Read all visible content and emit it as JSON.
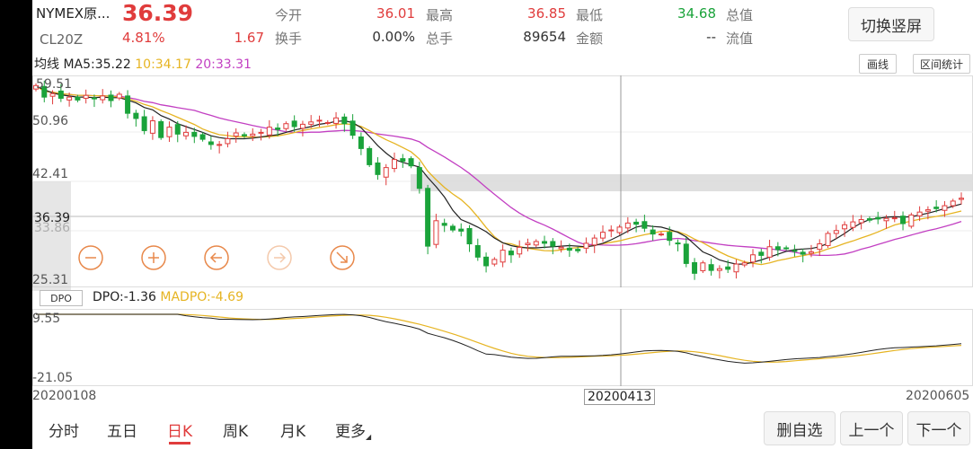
{
  "quote": {
    "name": "NYMEX原...",
    "code": "CL20Z",
    "price": "36.39",
    "change_pct": "4.81%",
    "change": "1.67",
    "fields": [
      {
        "label": "今开",
        "value": "36.01",
        "color": "#e03c3c"
      },
      {
        "label": "最高",
        "value": "36.85",
        "color": "#e03c3c"
      },
      {
        "label": "最低",
        "value": "34.68",
        "color": "#1aa33a"
      },
      {
        "label": "总值",
        "value": "--",
        "color": "#333333"
      },
      {
        "label": "换手",
        "value": "0.00%",
        "color": "#333333"
      },
      {
        "label": "总手",
        "value": "89654",
        "color": "#333333"
      },
      {
        "label": "金额",
        "value": "--",
        "color": "#333333"
      },
      {
        "label": "流值",
        "value": "--",
        "color": "#333333"
      }
    ],
    "switch_label": "切换竖屏"
  },
  "ma_header": {
    "title": "均线",
    "ma5": "MA5:35.22",
    "ma10": "10:34.17",
    "ma20": "20:33.31",
    "draw_label": "画线",
    "range_stat_label": "区间统计"
  },
  "price_axis": {
    "top": "59.51",
    "l2": "50.96",
    "l3": "42.41",
    "current": "36.39",
    "l4": "33.86",
    "bottom": "25.31"
  },
  "indicator": {
    "badge": "DPO",
    "dpo": "DPO:-1.36",
    "madpo": "MADPO:-4.69",
    "top": "9.55",
    "bottom": "-21.05"
  },
  "dates": {
    "start": "20200108",
    "cursor": "20200413",
    "end": "20200605"
  },
  "tabs": [
    "分时",
    "五日",
    "日K",
    "周K",
    "月K",
    "更多"
  ],
  "buttons": {
    "delete": "删自选",
    "prev": "上一个",
    "next": "下一个"
  },
  "colors": {
    "up": "#e03c3c",
    "down": "#1aa33a",
    "ma5": "#222222",
    "ma10": "#e6b422",
    "ma20": "#c23fc2"
  },
  "chart_data": {
    "type": "candlestick",
    "ylim": [
      25.31,
      59.51
    ],
    "closes": [
      59.0,
      57.0,
      57.6,
      56.8,
      57.0,
      56.5,
      57.3,
      56.7,
      57.2,
      56.4,
      57.5,
      54.2,
      53.3,
      51.2,
      52.9,
      50.0,
      51.8,
      50.6,
      50.9,
      50.2,
      49.7,
      48.8,
      48.8,
      49.8,
      50.8,
      50.3,
      50.6,
      50.9,
      51.8,
      51.4,
      52.4,
      51.9,
      52.3,
      52.7,
      53.0,
      52.6,
      53.4,
      52.4,
      50.4,
      48.1,
      45.3,
      43.6,
      44.8,
      46.2,
      45.9,
      45.1,
      41.2,
      31.2,
      35.6,
      34.8,
      34.0,
      33.8,
      31.6,
      29.3,
      27.8,
      28.9,
      30.5,
      29.7,
      31.0,
      31.7,
      32.0,
      31.7,
      31.2,
      31.0,
      30.5,
      30.4,
      31.7,
      32.6,
      33.6,
      34.0,
      34.5,
      35.2,
      35.0,
      34.3,
      33.3,
      33.3,
      32.2,
      31.7,
      28.2,
      26.5,
      28.3,
      27.0,
      27.3,
      27.2,
      28.1,
      28.3,
      29.7,
      29.6,
      31.1,
      30.6,
      30.9,
      30.3,
      29.8,
      30.2,
      31.6,
      33.4,
      33.9,
      34.9,
      35.4,
      35.8,
      35.7,
      35.9,
      36.0,
      36.1,
      35.1,
      36.6,
      37.1,
      37.5,
      37.7,
      38.2,
      39.0,
      39.5
    ],
    "ma5": [
      58.9,
      58.3,
      57.7,
      57.4,
      57.2,
      57.0,
      57.0,
      56.9,
      57.0,
      56.9,
      56.9,
      56.5,
      56.0,
      55.2,
      54.8,
      53.8,
      53.2,
      52.4,
      51.9,
      51.4,
      50.9,
      50.3,
      50.0,
      49.8,
      49.8,
      49.8,
      49.9,
      50.1,
      50.3,
      50.5,
      50.9,
      51.3,
      51.6,
      51.9,
      52.3,
      52.5,
      52.8,
      52.9,
      52.6,
      51.7,
      50.2,
      48.6,
      47.3,
      46.2,
      45.7,
      45.3,
      44.9,
      43.1,
      41.5,
      39.7,
      37.4,
      35.8,
      35.2,
      34.5,
      33.7,
      32.6,
      31.8,
      31.3,
      31.0,
      30.9,
      30.9,
      31.0,
      31.1,
      31.2,
      31.3,
      31.2,
      31.1,
      31.3,
      31.7,
      32.3,
      33.0,
      33.8,
      34.5,
      34.8,
      34.6,
      34.5,
      34.1,
      33.6,
      32.8,
      31.5,
      30.2,
      29.6,
      28.8,
      28.4,
      28.1,
      28.1,
      28.4,
      28.8,
      29.3,
      29.8,
      30.3,
      30.6,
      30.7,
      30.8,
      31.1,
      31.7,
      32.5,
      33.4,
      34.4,
      35.2,
      35.8,
      36.0,
      36.2,
      36.3,
      36.2,
      36.3,
      36.6,
      36.9,
      37.3,
      37.7,
      38.1,
      38.5
    ]
  }
}
